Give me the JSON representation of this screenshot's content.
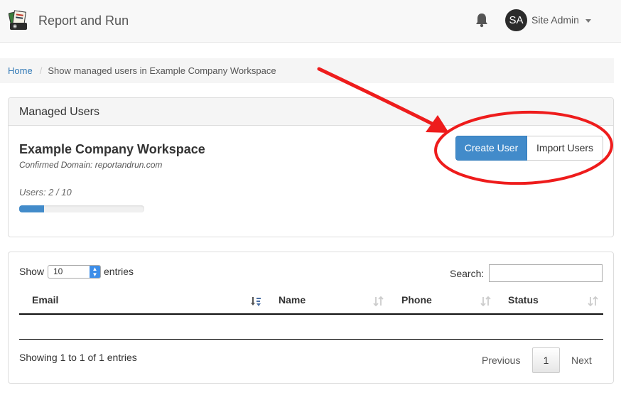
{
  "navbar": {
    "brand_name": "Report and Run",
    "user": {
      "initials": "SA",
      "name": "Site Admin"
    },
    "icons": {
      "logo": "app-logo-icon",
      "notifications": "bell-icon",
      "dropdown": "caret-down-icon"
    }
  },
  "breadcrumb": {
    "home": "Home",
    "separator": "/",
    "current": "Show managed users in Example Company Workspace"
  },
  "managed_panel": {
    "heading": "Managed Users",
    "workspace_title": "Example Company Workspace",
    "confirmed_domain": "Confirmed Domain: reportandrun.com",
    "users_label": "Users: 2 / 10",
    "progress_fraction": 0.2,
    "create_button": "Create User",
    "import_button": "Import Users"
  },
  "table_panel": {
    "show_label": "Show",
    "entries_value": "10",
    "entries_label": "entries",
    "search_label": "Search:",
    "search_value": "",
    "columns": [
      "Email",
      "Name",
      "Phone",
      "Status"
    ],
    "info": "Showing 1 to 1 of 1 entries",
    "pagination": {
      "previous": "Previous",
      "page": "1",
      "next": "Next"
    }
  },
  "colors": {
    "primary": "#428bca",
    "annotation": "#ee1c1c",
    "link": "#337ab7"
  }
}
